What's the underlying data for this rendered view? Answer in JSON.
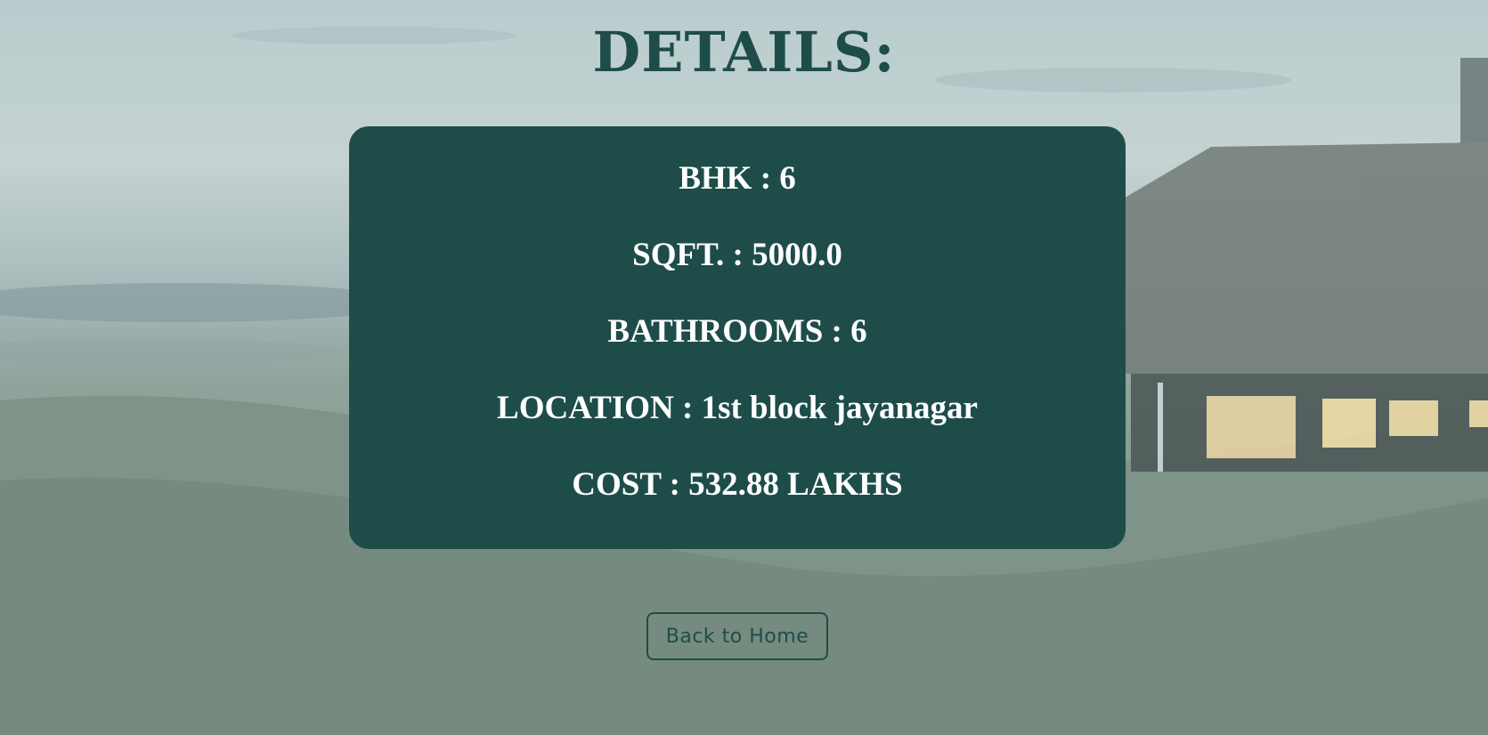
{
  "page": {
    "title": "DETAILS:"
  },
  "details": {
    "bhk": "BHK : 6",
    "sqft": "SQFT. : 5000.0",
    "bathrooms": "BATHROOMS : 6",
    "location": "LOCATION : 1st block jayanagar",
    "cost": "COST : 532.88 LAKHS"
  },
  "actions": {
    "back_label": "Back to Home"
  },
  "colors": {
    "accent": "#1e4d49",
    "card_text": "#ffffff",
    "background": "#a9bcbc"
  }
}
